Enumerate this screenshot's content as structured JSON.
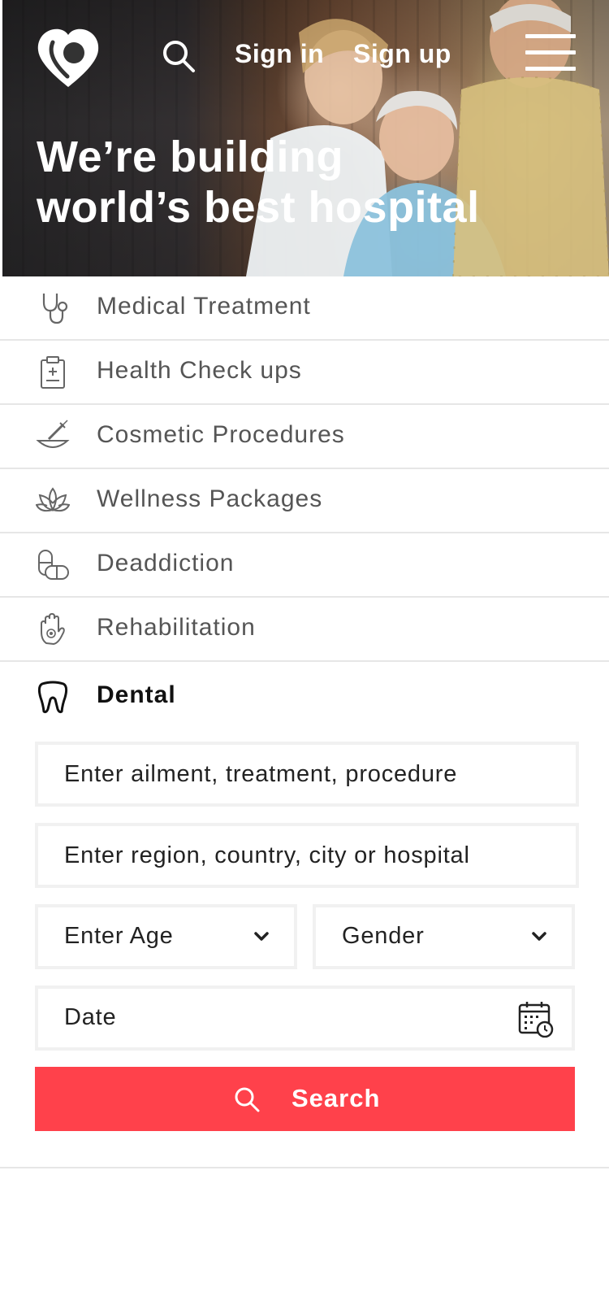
{
  "header": {
    "sign_in": "Sign in",
    "sign_up": "Sign up",
    "logo_icon": "location-pin-heart-logo",
    "search_icon": "search-icon",
    "menu_icon": "hamburger-menu-icon"
  },
  "hero": {
    "title_line1": "We’re building",
    "title_line2": "world’s best hospital"
  },
  "categories": [
    {
      "label": "Medical Treatment",
      "icon": "stethoscope-icon"
    },
    {
      "label": "Health Check ups",
      "icon": "clipboard-icon"
    },
    {
      "label": "Cosmetic Procedures",
      "icon": "syringe-bowl-icon"
    },
    {
      "label": "Wellness Packages",
      "icon": "lotus-icon"
    },
    {
      "label": "Deaddiction",
      "icon": "pills-icon"
    },
    {
      "label": "Rehabilitation",
      "icon": "hand-icon"
    },
    {
      "label": "Dental",
      "icon": "tooth-icon",
      "active": true
    }
  ],
  "form": {
    "ailment_placeholder": "Enter ailment, treatment, procedure",
    "location_placeholder": "Enter region, country, city or hospital",
    "age_label": "Enter Age",
    "gender_label": "Gender",
    "date_label": "Date",
    "search_label": "Search"
  },
  "colors": {
    "accent": "#ff414b",
    "divider": "#e6e6e6",
    "field_border": "#f1f1f1"
  }
}
